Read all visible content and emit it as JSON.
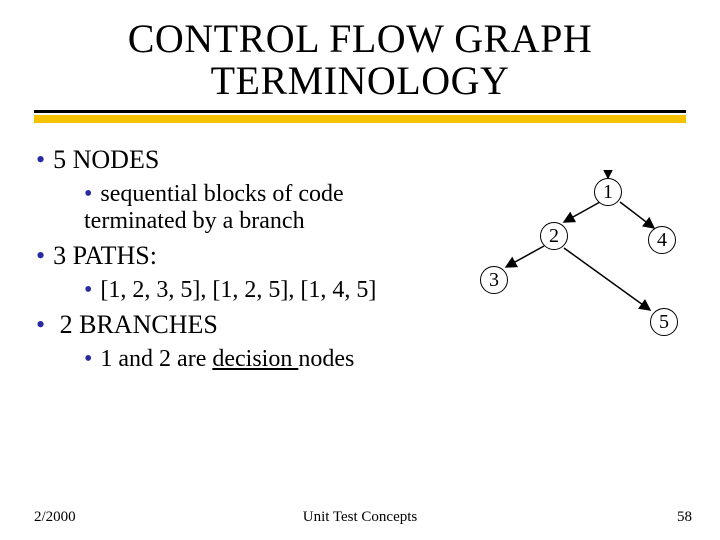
{
  "title_line1": "CONTROL FLOW GRAPH",
  "title_line2": "TERMINOLOGY",
  "bullets": {
    "nodes": {
      "label": "5 NODES",
      "sub": "sequential blocks of code terminated by a branch"
    },
    "paths": {
      "label": "3 PATHS:",
      "sub": "[1, 2, 3, 5], [1, 2, 5], [1, 4, 5]"
    },
    "branches": {
      "label": "2 BRANCHES",
      "sub_prefix": "1 and 2 are ",
      "sub_underlined": "decision ",
      "sub_suffix": "nodes"
    }
  },
  "diagram": {
    "nodes": {
      "n1": "1",
      "n2": "2",
      "n3": "3",
      "n4": "4",
      "n5": "5"
    }
  },
  "footer": {
    "left": "2/2000",
    "center": "Unit Test Concepts",
    "right": "58"
  }
}
